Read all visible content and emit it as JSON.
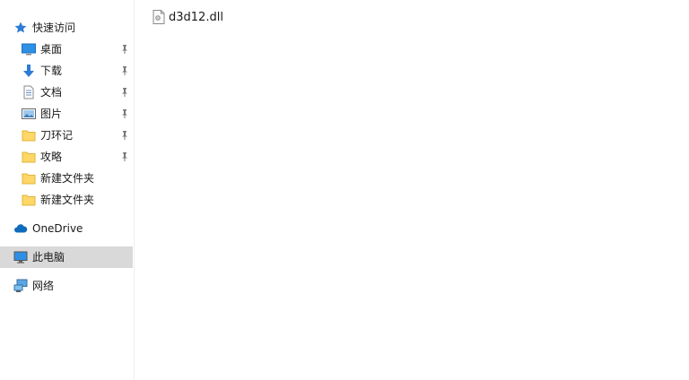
{
  "navigation": {
    "quick_access": {
      "label": "快速访问",
      "icon": "star-icon"
    },
    "pinned_items": [
      {
        "label": "桌面",
        "icon": "desktop-icon",
        "pinned": true
      },
      {
        "label": "下载",
        "icon": "download-icon",
        "pinned": true
      },
      {
        "label": "文档",
        "icon": "document-icon",
        "pinned": true
      },
      {
        "label": "图片",
        "icon": "picture-icon",
        "pinned": true
      },
      {
        "label": "刀环记",
        "icon": "folder-icon",
        "pinned": true
      },
      {
        "label": "攻略",
        "icon": "folder-icon",
        "pinned": true
      },
      {
        "label": "新建文件夹",
        "icon": "folder-icon",
        "pinned": false
      },
      {
        "label": "新建文件夹",
        "icon": "folder-icon",
        "pinned": false
      }
    ],
    "onedrive": {
      "label": "OneDrive",
      "icon": "cloud-icon"
    },
    "this_pc": {
      "label": "此电脑",
      "icon": "computer-icon",
      "selected": true
    },
    "network": {
      "label": "网络",
      "icon": "network-icon"
    }
  },
  "content": {
    "files": [
      {
        "name": "d3d12.dll",
        "icon": "dll-file-icon"
      }
    ]
  },
  "colors": {
    "selected_bg": "#d9d9d9",
    "folder_yellow": "#ffd766",
    "accent_blue": "#2d7cd6"
  }
}
